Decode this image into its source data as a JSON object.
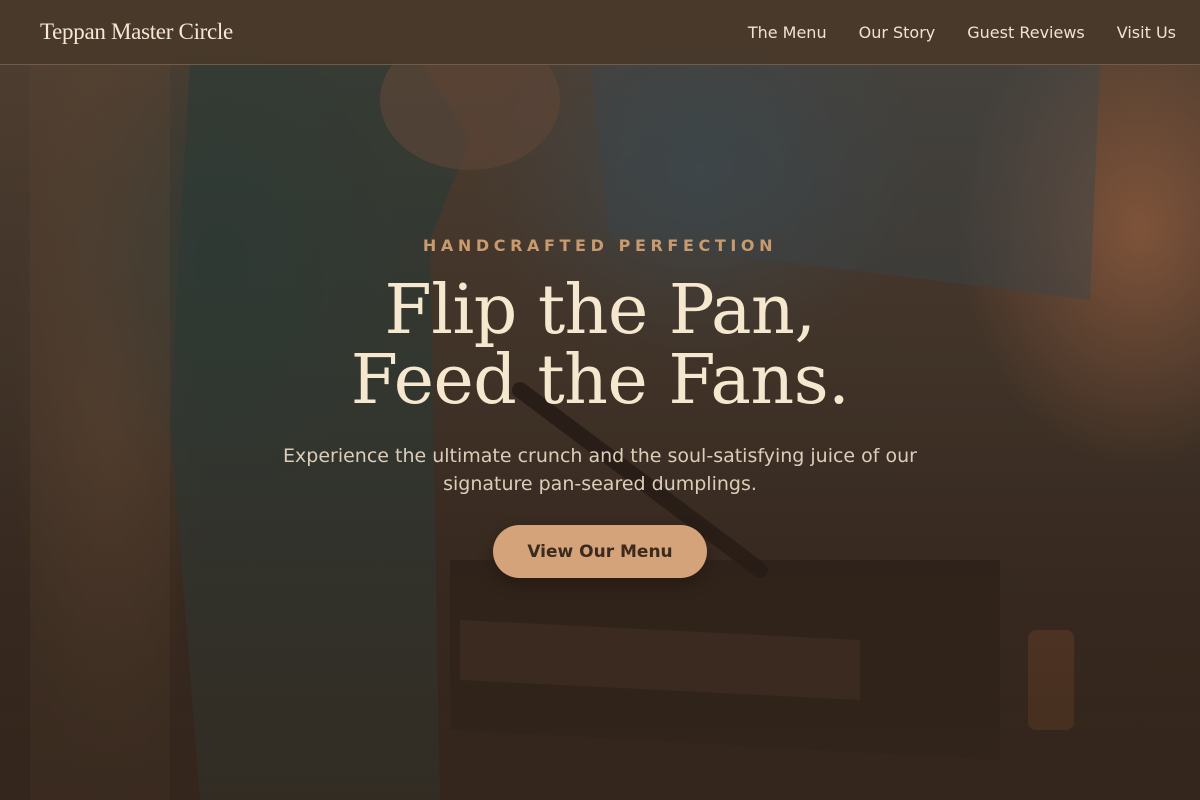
{
  "brand": {
    "name": "Teppan Master Circle"
  },
  "nav": {
    "items": [
      {
        "label": "The Menu"
      },
      {
        "label": "Our Story"
      },
      {
        "label": "Guest Reviews"
      },
      {
        "label": "Visit Us"
      }
    ]
  },
  "hero": {
    "eyebrow": "HANDCRAFTED PERFECTION",
    "headline_line1": "Flip the Pan,",
    "headline_line2": "Feed the Fans.",
    "subtext": "Experience the ultimate crunch and the soul-satisfying juice of our signature pan-seared dumplings.",
    "cta_label": "View Our Menu"
  },
  "colors": {
    "accent": "#d4a37a",
    "eyebrow": "#c99a6e",
    "headline": "#f6e8cf",
    "nav_bg": "#48382a"
  }
}
